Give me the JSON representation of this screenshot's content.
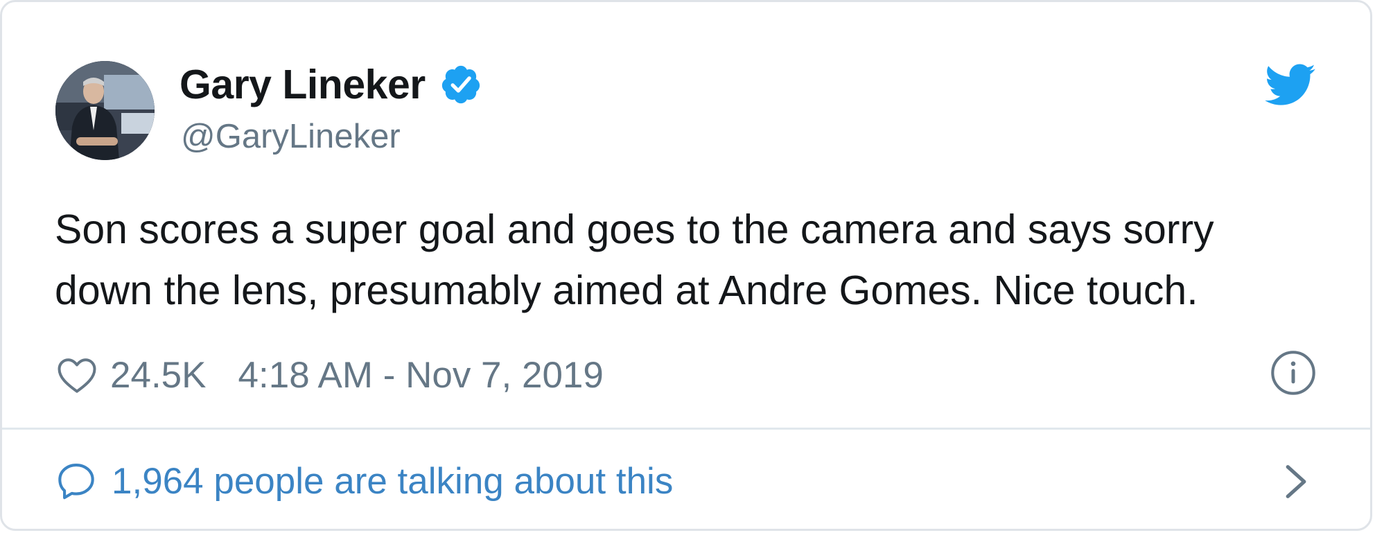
{
  "author": {
    "display_name": "Gary Lineker",
    "handle": "@GaryLineker",
    "verified": true,
    "avatar": "profile-photo"
  },
  "tweet": {
    "text_line_1": "Son scores a super goal and goes to the camera and says sorry",
    "text_line_2": "down the lens, presumably aimed at Andre Gomes. Nice touch."
  },
  "stats": {
    "likes": "24.5K",
    "timestamp": "4:18 AM - Nov 7, 2019"
  },
  "footer": {
    "talking_text": "1,964 people are talking about this"
  },
  "icons": {
    "brand": "twitter-bird-icon",
    "verified": "verified-badge-icon",
    "like": "heart-icon",
    "info": "info-icon",
    "reply": "speech-bubble-icon",
    "chevron": "chevron-right-icon"
  },
  "colors": {
    "brand_blue": "#1da1f2",
    "link_blue": "#3b84c4",
    "text": "#14171a",
    "secondary_text": "#657786",
    "border": "#e1e8ed"
  }
}
